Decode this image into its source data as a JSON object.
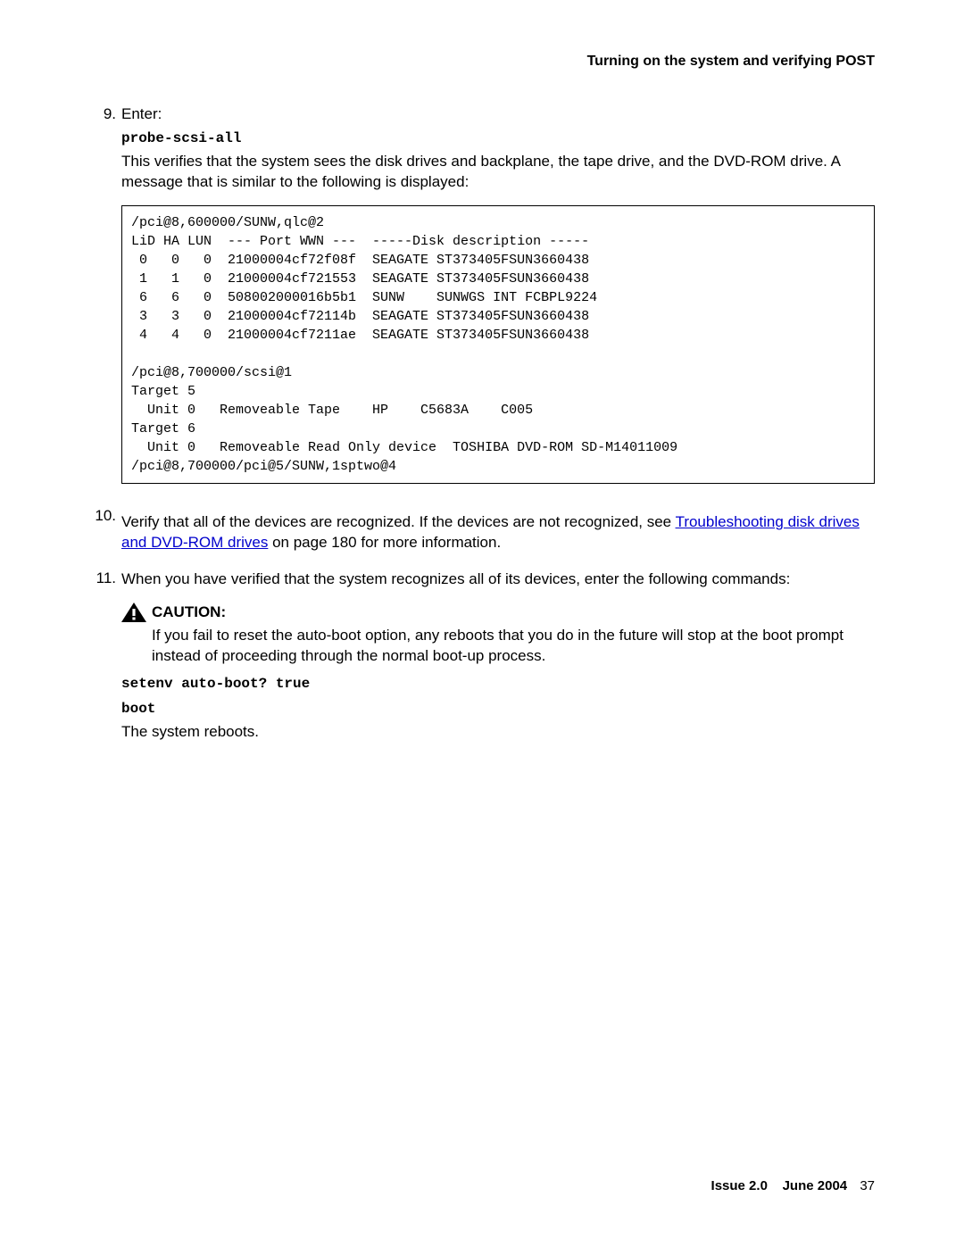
{
  "header": {
    "title": "Turning on the system and verifying POST"
  },
  "steps": [
    {
      "number": "9.",
      "intro": "Enter:",
      "command": "probe-scsi-all",
      "explain": "This verifies that the system sees the disk drives and backplane, the tape drive, and the DVD-ROM drive. A message that is similar to the following is displayed:",
      "codeblock": "/pci@8,600000/SUNW,qlc@2\nLiD HA LUN  --- Port WWN ---  -----Disk description -----\n 0   0   0  21000004cf72f08f  SEAGATE ST373405FSUN3660438\n 1   1   0  21000004cf721553  SEAGATE ST373405FSUN3660438\n 6   6   0  508002000016b5b1  SUNW    SUNWGS INT FCBPL9224\n 3   3   0  21000004cf72114b  SEAGATE ST373405FSUN3660438\n 4   4   0  21000004cf7211ae  SEAGATE ST373405FSUN3660438\n\n/pci@8,700000/scsi@1\nTarget 5\n  Unit 0   Removeable Tape    HP    C5683A    C005\nTarget 6\n  Unit 0   Removeable Read Only device  TOSHIBA DVD-ROM SD-M14011009\n/pci@8,700000/pci@5/SUNW,1sptwo@4"
    },
    {
      "number": "10.",
      "text_before_link": "Verify that all of the devices are recognized. If the devices are not recognized, see ",
      "link": "Troubleshooting disk drives and DVD-ROM drives",
      "text_after_link": " on page 180 for more information."
    },
    {
      "number": "11.",
      "intro": "When you have verified that the system recognizes all of its devices, enter the following commands:",
      "caution_label": "CAUTION:",
      "caution_text": "If you fail to reset the auto-boot option, any reboots that you do in the future will stop at the boot prompt instead of proceeding through the normal boot-up process.",
      "command1": "setenv auto-boot? true",
      "command2": "boot",
      "result": "The system reboots."
    }
  ],
  "footer": {
    "issue": "Issue 2.0",
    "date": "June 2004",
    "page": "37"
  }
}
